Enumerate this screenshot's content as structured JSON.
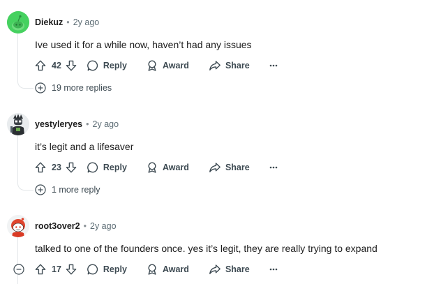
{
  "comments": [
    {
      "username": "Diekuz",
      "separator": "•",
      "age": "2y ago",
      "body": "Ive used it for a while now, haven’t had any issues",
      "score": "42",
      "reply_label": "Reply",
      "award_label": "Award",
      "share_label": "Share",
      "more_replies": "19 more replies",
      "avatar_icon": "snoo-avatar-green"
    },
    {
      "username": "yestyleryes",
      "separator": "•",
      "age": "2y ago",
      "body": "it’s legit and a lifesaver",
      "score": "23",
      "reply_label": "Reply",
      "award_label": "Award",
      "share_label": "Share",
      "more_replies": "1 more reply",
      "avatar_icon": "custom-avatar-dark"
    },
    {
      "username": "root3over2",
      "separator": "•",
      "age": "2y ago",
      "body": "talked to one of the founders once. yes it’s legit, they are really trying to expand",
      "score": "17",
      "reply_label": "Reply",
      "award_label": "Award",
      "share_label": "Share",
      "avatar_icon": "snoo-avatar-red-hair"
    }
  ],
  "colors": {
    "text": "#1c1c1c",
    "meta": "#5c6c74",
    "action": "#3d4a52",
    "thread_line": "#e2e6e8",
    "avatar_green": "#46d160"
  }
}
